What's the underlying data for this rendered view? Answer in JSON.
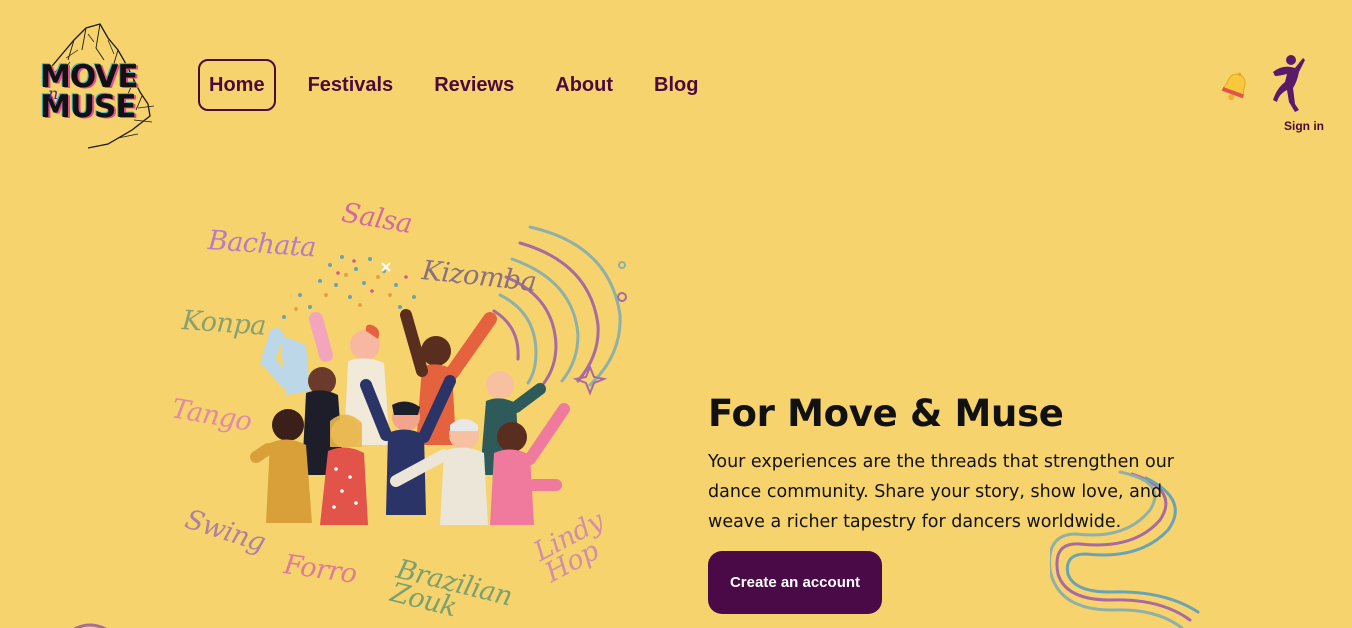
{
  "brand": {
    "logo_word_top": "MOVE",
    "logo_word_mid": "n",
    "logo_word_bottom": "MUSE"
  },
  "nav": {
    "items": [
      {
        "label": "Home",
        "active": true
      },
      {
        "label": "Festivals"
      },
      {
        "label": "Reviews"
      },
      {
        "label": "About"
      },
      {
        "label": "Blog"
      }
    ]
  },
  "header": {
    "notification_icon": "bell-icon",
    "user_icon": "dancer-icon",
    "signin_label": "Sign in"
  },
  "hero": {
    "title": "For Move & Muse",
    "body": "Your experiences are the threads that strengthen our dance community. Share your story, show love, and weave a richer tapestry for dancers worldwide.",
    "cta_label": "Create an account",
    "dance_styles": [
      "Bachata",
      "Salsa",
      "Kizomba",
      "Konpa",
      "Tango",
      "Swing",
      "Forro",
      "Brazilian Zouk",
      "Lindy Hop"
    ]
  },
  "colors": {
    "background": "#f6d36c",
    "accent": "#4a0a3c",
    "button": "#4a0a47"
  }
}
